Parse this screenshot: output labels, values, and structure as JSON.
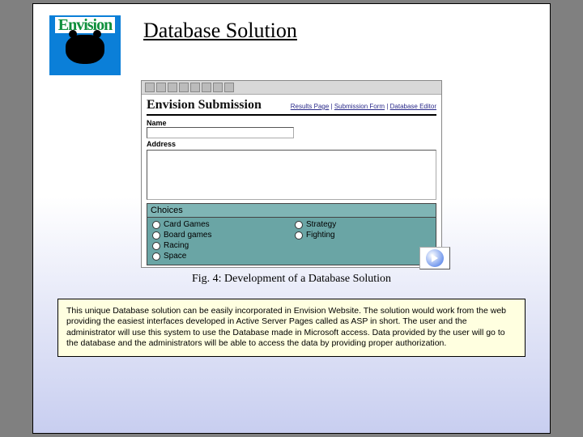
{
  "logo": {
    "text": "Envision"
  },
  "title": "Database Solution",
  "browser": {
    "heading": "Envision Submission",
    "nav": [
      "Results Page",
      "Submission Form",
      "Database Editor"
    ],
    "fields": {
      "name_label": "Name",
      "address_label": "Address"
    },
    "choices": {
      "title": "Choices",
      "options_col1": [
        "Card Games",
        "Board games",
        "Racing",
        "Space"
      ],
      "options_col2": [
        "Strategy",
        "Fighting"
      ]
    }
  },
  "caption": "Fig. 4: Development of a Database Solution",
  "description": "This unique Database solution can be easily incorporated in Envision Website. The solution would work from the web providing the easiest interfaces developed in Active Server Pages called as ASP in short. The user and the administrator will use this system to use the Database made in Microsoft access. Data provided by the user will go to the database and the administrators will be able to access the data by providing proper authorization."
}
